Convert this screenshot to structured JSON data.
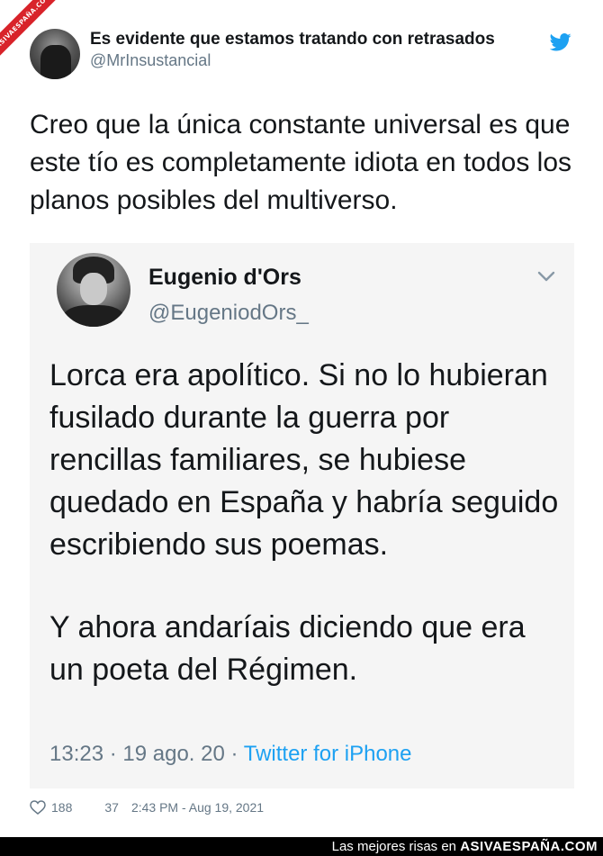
{
  "watermark": {
    "ribbon_text": "ASIVAESPAÑA.COM"
  },
  "tweet": {
    "author_name": "Es evidente que estamos tratando con retrasados",
    "author_handle": "@MrInsustancial",
    "text": "Creo que la única constante universal es que este tío es completamente idiota en todos los planos posibles del multiverso.",
    "likes": "188",
    "retweets": "37",
    "timestamp": "2:43 PM - Aug 19, 2021"
  },
  "quoted": {
    "author_name": "Eugenio d'Ors",
    "author_handle": "@EugeniodOrs_",
    "paragraph_1": "Lorca era apolítico. Si no lo hubieran fusilado durante la guerra por rencillas familiares, se hubiese quedado en España y habría seguido escribiendo sus poemas.",
    "paragraph_2": "Y ahora andaríais diciendo que era un poeta del Régimen.",
    "time": "13:23",
    "date": "19 ago. 20",
    "client": "Twitter for iPhone",
    "separator": " · "
  },
  "footer": {
    "tagline": "Las mejores risas en",
    "site": "ASIVAESPAÑA.COM"
  },
  "colors": {
    "twitter_blue": "#1da1f2",
    "ribbon_red": "#d8232a",
    "secondary_text": "#657786"
  },
  "icons": {
    "brand": "twitter-bird-icon",
    "menu": "chevron-down-icon",
    "like": "heart-icon"
  }
}
